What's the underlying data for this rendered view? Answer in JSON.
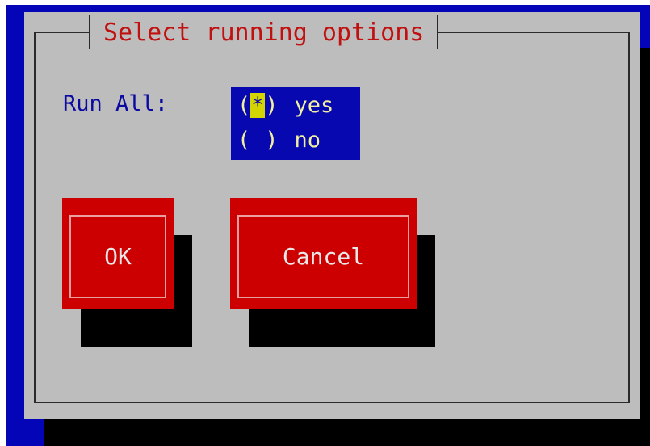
{
  "dialog": {
    "title": "Select running options"
  },
  "run_all": {
    "label": "Run All:",
    "options": [
      {
        "mark": "*",
        "label": "yes",
        "selected": true
      },
      {
        "mark": " ",
        "label": "no",
        "selected": false
      }
    ]
  },
  "buttons": {
    "ok_label": "OK",
    "cancel_label": "Cancel"
  },
  "colors": {
    "backdrop": "#0505b8",
    "dialog": "#bdbdbd",
    "title": "#c01010",
    "label": "#0a0aa0",
    "list_bg": "#0808b0",
    "list_text": "#f0f0a0",
    "cursor": "#d4d400",
    "button": "#cc0000"
  }
}
